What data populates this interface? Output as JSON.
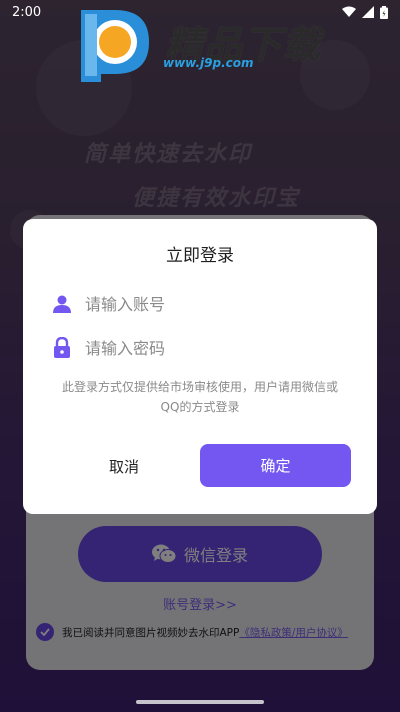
{
  "status_bar": {
    "time": "2:00",
    "icons": [
      "wifi-icon",
      "signal-icon",
      "battery-icon"
    ]
  },
  "logo": {
    "title": "精品下载",
    "url": "www.j9p.com"
  },
  "background": {
    "slogan_line1": "简单快速去水印",
    "slogan_line2": "便捷有效水印宝"
  },
  "login_page": {
    "wechat_button": "微信登录",
    "wechat_icon": "wechat-icon",
    "account_login_link": "账号登录>>",
    "agreement_text": "我已阅读并同意图片视频妙去水印APP",
    "agreement_link": "《隐私政策/用户协议》",
    "agreement_checked": true
  },
  "dialog": {
    "title": "立即登录",
    "account_placeholder": "请输入账号",
    "account_icon": "user-icon",
    "password_placeholder": "请输入密码",
    "password_icon": "lock-icon",
    "notice": "此登录方式仅提供给市场审核使用，用户请用微信或QQ的方式登录",
    "cancel_label": "取消",
    "confirm_label": "确定"
  },
  "colors": {
    "accent": "#7357f0",
    "accent_dark": "#6b48e8",
    "link": "#7b5cf0"
  }
}
